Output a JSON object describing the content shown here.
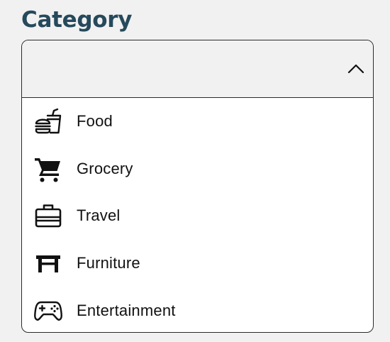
{
  "field": {
    "label": "Category"
  },
  "select": {
    "selected_value": "",
    "expanded": true,
    "toggle_icon": "chevron-up-icon",
    "options": [
      {
        "label": "Food",
        "icon": "food-icon"
      },
      {
        "label": "Grocery",
        "icon": "shopping-cart-icon"
      },
      {
        "label": "Travel",
        "icon": "briefcase-icon"
      },
      {
        "label": "Furniture",
        "icon": "table-icon"
      },
      {
        "label": "Entertainment",
        "icon": "gamepad-icon"
      }
    ]
  },
  "colors": {
    "label": "#26495c",
    "background": "#f1f1f1",
    "dropdown_background": "#ffffff",
    "border": "#2a2a2a",
    "text": "#111111"
  }
}
